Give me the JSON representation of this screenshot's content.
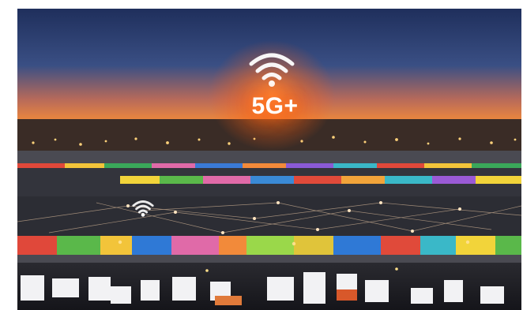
{
  "image": {
    "badge": {
      "label": "5G+"
    },
    "icons": [
      "wifi-icon",
      "wifi-icon"
    ],
    "colors": {
      "sky_top": "#223a6a",
      "sky_horizon": "#e8703a",
      "glow": "#ff6a1a",
      "roof_blue": "#2f79d6"
    }
  }
}
